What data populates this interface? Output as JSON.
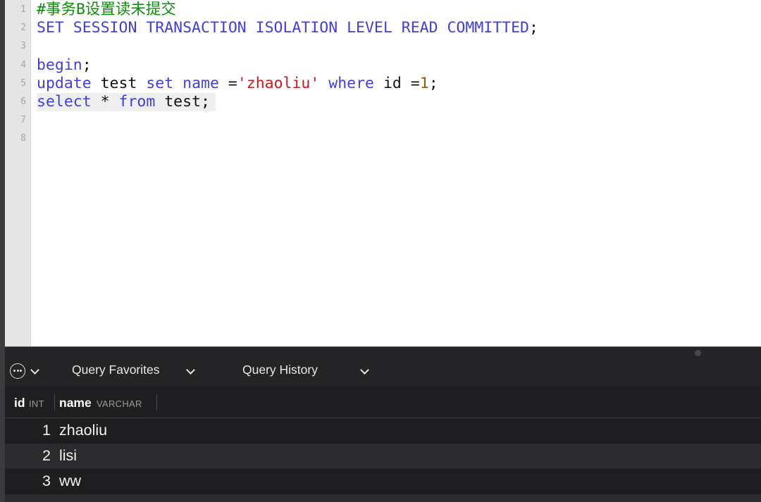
{
  "editor": {
    "lines": [
      {
        "num": "1",
        "tokens": [
          {
            "t": "#事务B设置读未提交",
            "c": "cm"
          }
        ]
      },
      {
        "num": "2",
        "tokens": [
          {
            "t": "SET SESSION TRANSACTION ISOLATION LEVEL READ COMMITTED",
            "c": "kw"
          },
          {
            "t": ";",
            "c": "pl"
          }
        ]
      },
      {
        "num": "3",
        "tokens": []
      },
      {
        "num": "4",
        "tokens": [
          {
            "t": "begin",
            "c": "kw"
          },
          {
            "t": ";",
            "c": "pl"
          }
        ]
      },
      {
        "num": "5",
        "tokens": [
          {
            "t": "update",
            "c": "kw"
          },
          {
            "t": " test ",
            "c": "pl"
          },
          {
            "t": "set",
            "c": "kw"
          },
          {
            "t": " ",
            "c": "pl"
          },
          {
            "t": "name",
            "c": "kw"
          },
          {
            "t": " =",
            "c": "pl"
          },
          {
            "t": "'zhaoliu'",
            "c": "st"
          },
          {
            "t": " ",
            "c": "pl"
          },
          {
            "t": "where",
            "c": "kw"
          },
          {
            "t": " id =",
            "c": "pl"
          },
          {
            "t": "1",
            "c": "nm"
          },
          {
            "t": ";",
            "c": "pl"
          }
        ]
      },
      {
        "num": "6",
        "current": true,
        "tokens": [
          {
            "t": "select",
            "c": "kw"
          },
          {
            "t": " * ",
            "c": "pl"
          },
          {
            "t": "from",
            "c": "kw"
          },
          {
            "t": " test;",
            "c": "pl"
          }
        ]
      },
      {
        "num": "7",
        "tokens": []
      },
      {
        "num": "8",
        "tokens": []
      }
    ]
  },
  "panel": {
    "more_icon": "ellipsis-circle-icon",
    "favorites_label": "Query Favorites",
    "history_label": "Query History"
  },
  "results": {
    "columns": [
      {
        "name": "id",
        "type": "INT"
      },
      {
        "name": "name",
        "type": "VARCHAR"
      }
    ],
    "rows": [
      {
        "id": "1",
        "name": "zhaoliu"
      },
      {
        "id": "2",
        "name": "lisi"
      },
      {
        "id": "3",
        "name": "ww"
      }
    ]
  },
  "colors": {
    "keyword": "#3f3fdf",
    "comment": "#0b8f0b",
    "string": "#cc1a1a",
    "number": "#9a5d00"
  }
}
